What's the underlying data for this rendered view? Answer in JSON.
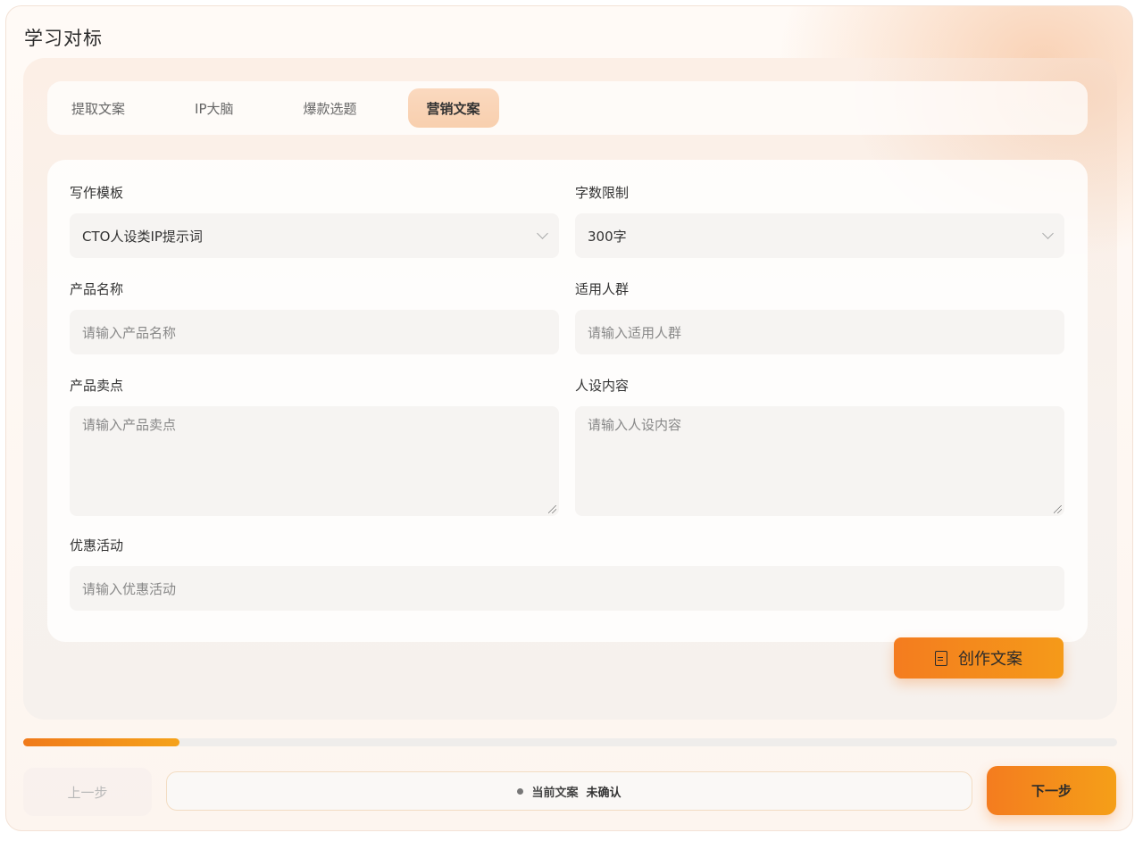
{
  "page_title": "学习对标",
  "tabs": [
    {
      "label": "提取文案",
      "active": false
    },
    {
      "label": "IP大脑",
      "active": false
    },
    {
      "label": "爆款选题",
      "active": false
    },
    {
      "label": "营销文案",
      "active": true
    }
  ],
  "form": {
    "writing_template": {
      "label": "写作模板",
      "value": "CTO人设类IP提示词"
    },
    "word_limit": {
      "label": "字数限制",
      "value": "300字"
    },
    "product_name": {
      "label": "产品名称",
      "placeholder": "请输入产品名称"
    },
    "target_audience": {
      "label": "适用人群",
      "placeholder": "请输入适用人群"
    },
    "selling_points": {
      "label": "产品卖点",
      "placeholder": "请输入产品卖点"
    },
    "persona_content": {
      "label": "人设内容",
      "placeholder": "请输入人设内容"
    },
    "promotion": {
      "label": "优惠活动",
      "placeholder": "请输入优惠活动"
    }
  },
  "create_button": {
    "label": "创作文案",
    "icon": "document-icon"
  },
  "progress": {
    "fraction": 0.143
  },
  "footer": {
    "prev_label": "上一步",
    "status_label": "当前文案",
    "status_value": "未确认",
    "next_label": "下一步"
  },
  "colors": {
    "accent_start": "#f47c1f",
    "accent_end": "#f59f18",
    "active_tab": "#f8cfae"
  }
}
